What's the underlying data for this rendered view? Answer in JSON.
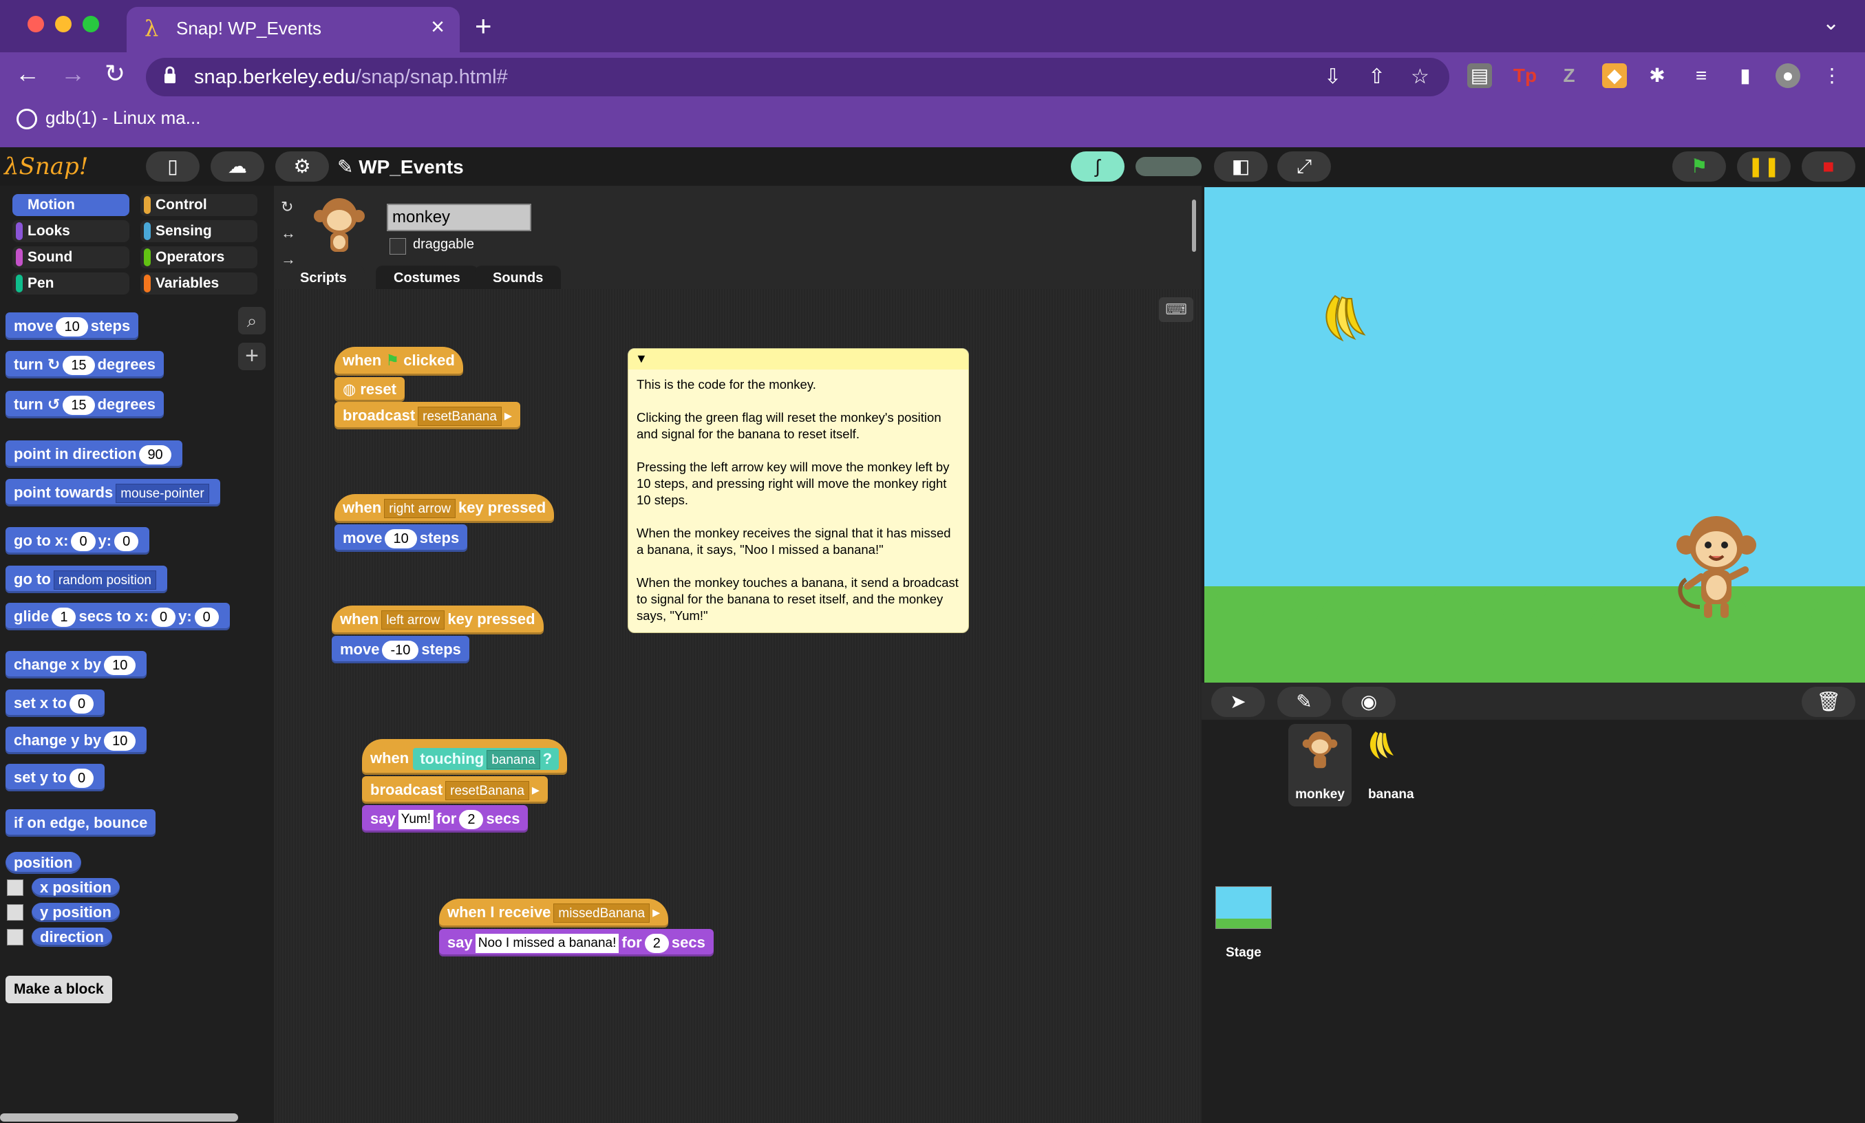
{
  "browser": {
    "tab_title": "Snap! WP_Events",
    "url_host": "snap.berkeley.edu",
    "url_path": "/snap/snap.html#",
    "bookmark": "gdb(1) - Linux ma..."
  },
  "snap": {
    "project_name": "WP_Events",
    "categories": [
      "Motion",
      "Control",
      "Looks",
      "Sensing",
      "Sound",
      "Operators",
      "Pen",
      "Variables"
    ],
    "sprite_name": "monkey",
    "draggable_label": "draggable",
    "tabs": [
      "Scripts",
      "Costumes",
      "Sounds"
    ]
  },
  "palette": {
    "move": "move",
    "move_val": "10",
    "steps": "steps",
    "turn": "turn",
    "turn_val": "15",
    "degrees": "degrees",
    "turn2_val": "15",
    "point_dir": "point in direction",
    "point_dir_val": "90",
    "point_towards": "point towards",
    "point_towards_val": "mouse-pointer",
    "goto_xy": "go to x:",
    "goto_x": "0",
    "y_label": "y:",
    "goto_y": "0",
    "goto": "go to",
    "goto_val": "random position",
    "glide": "glide",
    "glide_val": "1",
    "secs_to_x": "secs to x:",
    "glide_x": "0",
    "glide_y": "0",
    "change_x": "change x by",
    "change_x_val": "10",
    "set_x": "set x to",
    "set_x_val": "0",
    "change_y": "change y by",
    "change_y_val": "10",
    "set_y": "set y to",
    "set_y_val": "0",
    "bounce": "if on edge, bounce",
    "position": "position",
    "x_position": "x position",
    "y_position": "y position",
    "direction": "direction",
    "make_block": "Make a block"
  },
  "scripts": {
    "when": "when",
    "clicked": "clicked",
    "reset": "reset",
    "broadcast": "broadcast",
    "reset_banana": "resetBanana",
    "key_pressed": "key pressed",
    "right_arrow": "right arrow",
    "left_arrow": "left arrow",
    "move": "move",
    "steps": "steps",
    "move_r": "10",
    "move_l": "-10",
    "touching": "touching",
    "banana": "banana",
    "q": "?",
    "say": "say",
    "yum": "Yum!",
    "for": "for",
    "secs": "secs",
    "two": "2",
    "when_receive": "when I receive",
    "missed_banana": "missedBanana",
    "noo": "Noo I missed a banana!"
  },
  "comment": "This is the code for the monkey.\n\nClicking the green flag will reset the monkey's position and signal for the banana to reset itself.\n\nPressing the left arrow key will move the monkey left by 10 steps, and pressing right will move the monkey right 10 steps.\n\nWhen the monkey receives the signal that it has missed a banana, it says, \"Noo I missed a banana!\"\n\nWhen the monkey touches a banana, it send a broadcast to signal for the banana to reset itself, and the monkey says, \"Yum!\"",
  "corral": {
    "sprites": [
      "monkey",
      "banana"
    ],
    "stage": "Stage"
  },
  "colors": {
    "motion": "#4a6cd4",
    "control": "#e5a638",
    "sound": "#a14fd8",
    "sensing": "#4ecfb5",
    "browser": "#6a3fa3"
  }
}
